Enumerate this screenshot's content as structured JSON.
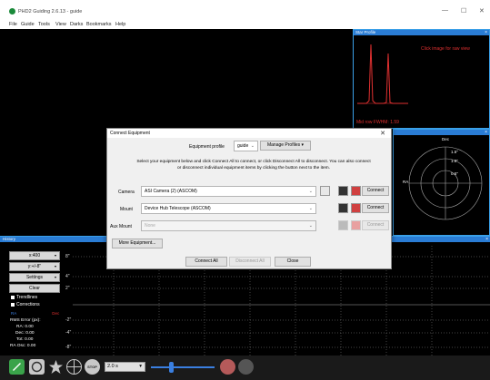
{
  "window": {
    "title": "PHD2 Guiding 2.6.13 - guide",
    "min": "—",
    "max": "☐",
    "close": "✕"
  },
  "menu": [
    "File",
    "Guide",
    "Tools",
    "View",
    "Darks",
    "Bookmarks",
    "Help"
  ],
  "star_profile": {
    "header": "Star Profile",
    "click_hint": "Click image for raw view",
    "fwhm": "Mid row FWHM: 1.59"
  },
  "target": {
    "label": "Dec",
    "ra_label": "RA",
    "rings": [
      "1.5\"",
      "1.0\"",
      "0.5\""
    ]
  },
  "history": {
    "header": "History",
    "x_scale": "x:400",
    "y_scale": "y:+/-8\"",
    "settings": "Settings",
    "clear": "Clear",
    "trendlines": "Trendlines",
    "corrections": "Corrections",
    "ra_legend": "RA",
    "dec_legend": "Dec",
    "rms_title": "RMS Error (px):",
    "ra_rms": "RA: 0.00",
    "dec_rms": "Dec: 0.00",
    "tot_rms": "Tot: 0.00",
    "ra_osc": "RA Osc: 0.00",
    "y_labels": [
      "8\"",
      "4\"",
      "2\"",
      "-2\"",
      "-4\"",
      "-8\""
    ]
  },
  "toolbar": {
    "exposure": "2.0 s",
    "stop": "STOP"
  },
  "dialog": {
    "title": "Connect Equipment",
    "close": "✕",
    "profile_label": "Equipment profile",
    "profile_value": "guide",
    "manage_profiles": "Manage Profiles",
    "instructions": "Select your equipment below and click Connect All to connect, or click Disconnect All to disconnect. You can also connect or disconnect individual equipment items by clicking the button next to the item.",
    "rows": [
      {
        "label": "Camera",
        "value": "ASI Camera (2) (ASCOM)",
        "button": "Connect",
        "enabled": true
      },
      {
        "label": "Mount",
        "value": "Device Hub Telescope (ASCOM)",
        "button": "Connect",
        "enabled": true
      },
      {
        "label": "Aux Mount",
        "value": "None",
        "button": "Connect",
        "enabled": false
      }
    ],
    "more_equipment": "More Equipment...",
    "connect_all": "Connect All",
    "disconnect_all": "Disconnect All",
    "close_button": "Close"
  },
  "colors": {
    "accent": "#2a7cd4",
    "ra": "#3a7fe0",
    "dec": "#e03030",
    "profile_line": "#e03030"
  }
}
